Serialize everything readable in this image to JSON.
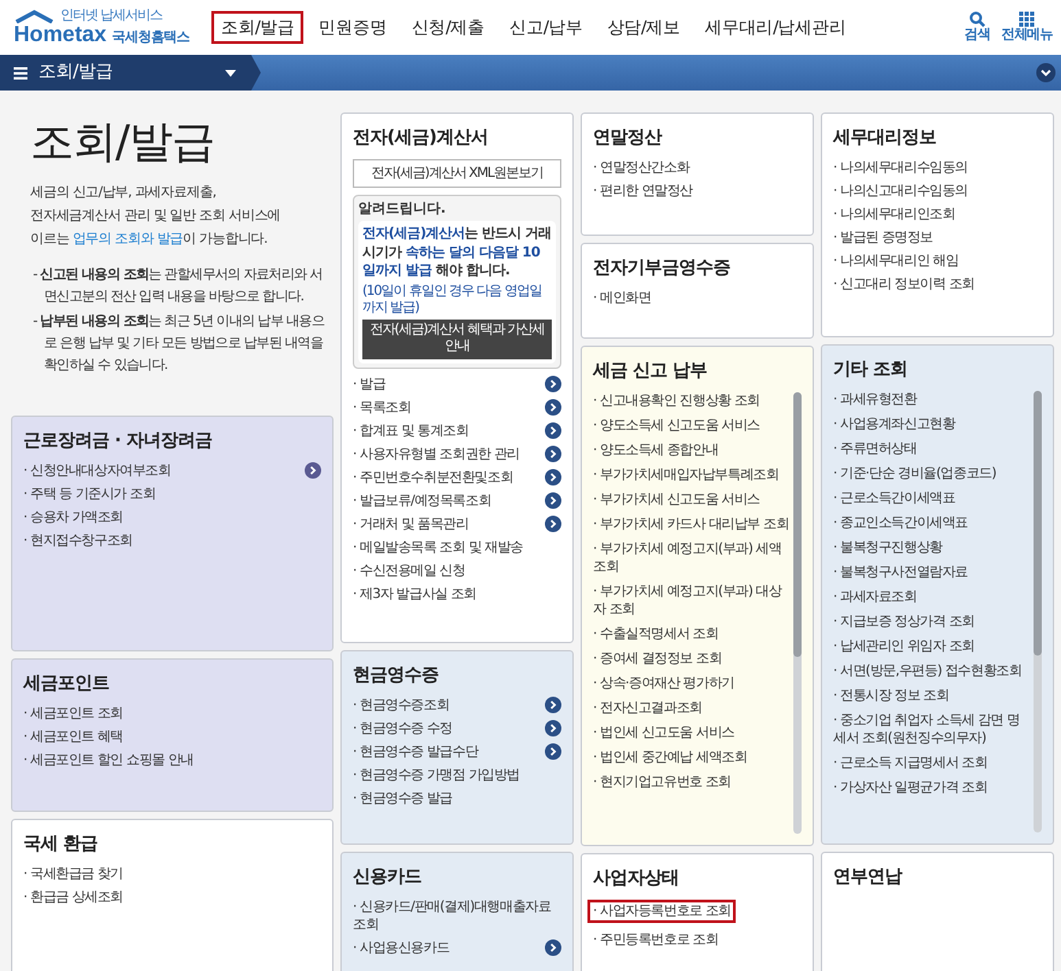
{
  "header": {
    "logo": {
      "tagline": "인터넷 납세서비스",
      "wordmark": "Hometax",
      "name": "국세청홈택스"
    },
    "nav": [
      {
        "label": "조회/발급",
        "selected": true
      },
      {
        "label": "민원증명",
        "selected": false
      },
      {
        "label": "신청/제출",
        "selected": false
      },
      {
        "label": "신고/납부",
        "selected": false
      },
      {
        "label": "상담/제보",
        "selected": false
      },
      {
        "label": "세무대리/납세관리",
        "selected": false
      }
    ],
    "tools": [
      {
        "label": "검색",
        "kind": "search"
      },
      {
        "label": "전체메뉴",
        "kind": "menu"
      }
    ]
  },
  "breadcrumb": {
    "label": "조회/발급"
  },
  "intro": {
    "title": "조회/발급",
    "description": [
      {
        "text": "세금의 신고/납부, 과세자료제출,\n전자세금계산서 관리 및 일반 조회 서비스에\n이르는 ",
        "emphasis": false
      },
      {
        "text": "업무의 조회와 발급",
        "emphasis": true
      },
      {
        "text": "이 가능합니다.",
        "emphasis": false
      }
    ],
    "notes": [
      "- **신고된 내용의 조회**는 관할세무서의 자료처리와 서면신고분의 전산 입력 내용을 바탕으로 합니다.",
      "- **납부된 내용의 조회**는 최근 5년 이내의 납부 내용으로 은행 납부 및 기타 모든 방법으로 납부된 내역을 확인하실 수 있습니다."
    ]
  },
  "columns": [
    {
      "cards": [
        {
          "title": "근로장려금 · 자녀장려금",
          "color": "#dedff2",
          "items": [
            {
              "text": "· 신청안내대상자여부조회",
              "arrow": true
            },
            {
              "text": "· 주택 등 기준시가 조회",
              "arrow": false
            },
            {
              "text": "· 승용차 가액조회",
              "arrow": false
            },
            {
              "text": "· 현지접수창구조회",
              "arrow": false
            }
          ]
        },
        {
          "title": "세금포인트",
          "color": "#dedff2",
          "items": [
            {
              "text": "· 세금포인트 조회"
            },
            {
              "text": "· 세금포인트 혜택"
            },
            {
              "text": "· 세금포인트 할인 쇼핑몰 안내"
            }
          ]
        },
        {
          "title": "국세 환급",
          "color": "#ffffff",
          "items": [
            {
              "text": "· 국세환급금 찾기"
            },
            {
              "text": "· 환급금 상세조회"
            }
          ]
        }
      ]
    },
    {
      "cards": [
        {
          "title": "전자(세금)계산서",
          "color": "#ffffff",
          "xml_button": "전자(세금)계산서 XML원본보기",
          "notice": {
            "heading": "알려드립니다.",
            "message": [
              {
                "text": "전자(세금)계산서",
                "emphasis": true
              },
              {
                "text": "는 반드시 거래시기가 ",
                "emphasis": false
              },
              {
                "text": "속하는 달의 다음달 10일까지 발급",
                "emphasis": true
              },
              {
                "text": " 해야 합니다.",
                "emphasis": false
              }
            ],
            "footnote": "(10일이 휴일인 경우 다음 영업일까지 발급)",
            "button": "전자(세금)계산서 혜택과 가산세 안내"
          },
          "items": [
            {
              "text": "· 발급",
              "arrow": true
            },
            {
              "text": "· 목록조회",
              "arrow": true
            },
            {
              "text": "· 합계표 및 통계조회",
              "arrow": true
            },
            {
              "text": "· 사용자유형별 조회권한 관리",
              "arrow": true
            },
            {
              "text": "· 주민번호수취분전환및조회",
              "arrow": true
            },
            {
              "text": "· 발급보류/예정목록조회",
              "arrow": true
            },
            {
              "text": "· 거래처 및 품목관리",
              "arrow": true
            },
            {
              "text": "· 메일발송목록 조회 및 재발송",
              "arrow": false
            },
            {
              "text": "· 수신전용메일 신청",
              "arrow": false
            },
            {
              "text": "· 제3자 발급사실 조회",
              "arrow": false
            }
          ]
        },
        {
          "title": "현금영수증",
          "color": "#e3ebf4",
          "items": [
            {
              "text": "· 현금영수증조회",
              "arrow": true
            },
            {
              "text": "· 현금영수증 수정",
              "arrow": true
            },
            {
              "text": "· 현금영수증 발급수단",
              "arrow": true
            },
            {
              "text": "· 현금영수증 가맹점 가입방법",
              "arrow": false
            },
            {
              "text": "· 현금영수증 발급",
              "arrow": false
            }
          ]
        },
        {
          "title": "신용카드",
          "color": "#e3ebf4",
          "items": [
            {
              "text": "· 신용카드/판매(결제)대행매출자료조회",
              "arrow": false
            },
            {
              "text": "· 사업용신용카드",
              "arrow": true
            }
          ]
        }
      ]
    },
    {
      "cards": [
        {
          "title": "연말정산",
          "color": "#ffffff",
          "items": [
            {
              "text": "· 연말정산간소화"
            },
            {
              "text": "· 편리한 연말정산"
            }
          ]
        },
        {
          "title": "전자기부금영수증",
          "color": "#ffffff",
          "items": [
            {
              "text": "· 메인화면"
            }
          ]
        },
        {
          "title": "세금 신고 납부",
          "color": "#fdfcee",
          "scrollable": true,
          "items": [
            {
              "text": "· 신고내용확인 진행상황 조회"
            },
            {
              "text": "· 양도소득세 신고도움 서비스"
            },
            {
              "text": "· 양도소득세 종합안내"
            },
            {
              "text": "· 부가가치세매입자납부특례조회"
            },
            {
              "text": "· 부가가치세 신고도움 서비스"
            },
            {
              "text": "· 부가가치세 카드사 대리납부 조회"
            },
            {
              "text": "· 부가가치세 예정고지(부과) 세액조회"
            },
            {
              "text": "· 부가가치세 예정고지(부과) 대상자 조회"
            },
            {
              "text": "· 수출실적명세서 조회"
            },
            {
              "text": "· 증여세 결정정보 조회"
            },
            {
              "text": "· 상속·증여재산 평가하기"
            },
            {
              "text": "· 전자신고결과조회"
            },
            {
              "text": "· 법인세 신고도움 서비스"
            },
            {
              "text": "· 법인세 중간예납 세액조회"
            },
            {
              "text": "· 현지기업고유번호 조회"
            }
          ]
        },
        {
          "title": "사업자상태",
          "color": "#ffffff",
          "items": [
            {
              "text": "· 사업자등록번호로 조회",
              "highlighted": true
            },
            {
              "text": "· 주민등록번호로 조회",
              "highlighted": false
            }
          ]
        }
      ]
    },
    {
      "cards": [
        {
          "title": "세무대리정보",
          "color": "#ffffff",
          "items": [
            {
              "text": "· 나의세무대리수임동의"
            },
            {
              "text": "· 나의신고대리수임동의"
            },
            {
              "text": "· 나의세무대리인조회"
            },
            {
              "text": "· 발급된 증명정보"
            },
            {
              "text": "· 나의세무대리인 해임"
            },
            {
              "text": "· 신고대리 정보이력 조회"
            }
          ]
        },
        {
          "title": "기타 조회",
          "color": "#e3ebf4",
          "scrollable": true,
          "items": [
            {
              "text": "· 과세유형전환"
            },
            {
              "text": "· 사업용계좌신고현황"
            },
            {
              "text": "· 주류면허상태"
            },
            {
              "text": "· 기준·단순 경비율(업종코드)"
            },
            {
              "text": "· 근로소득간이세액표"
            },
            {
              "text": "· 종교인소득간이세액표"
            },
            {
              "text": "· 불복청구진행상황"
            },
            {
              "text": "· 불복청구사전열람자료"
            },
            {
              "text": "· 과세자료조회"
            },
            {
              "text": "· 지급보증 정상가격 조회"
            },
            {
              "text": "· 납세관리인 위임자 조회"
            },
            {
              "text": "· 서면(방문,우편등) 접수현황조회"
            },
            {
              "text": "· 전통시장 정보 조회"
            },
            {
              "text": "· 중소기업 취업자 소득세 감면 명세서 조회(원천징수의무자)"
            },
            {
              "text": "· 근로소득 지급명세서 조회"
            },
            {
              "text": "· 가상자산 일평균가격 조회"
            }
          ]
        },
        {
          "title": "연부연납",
          "color": "#ffffff"
        }
      ]
    }
  ]
}
